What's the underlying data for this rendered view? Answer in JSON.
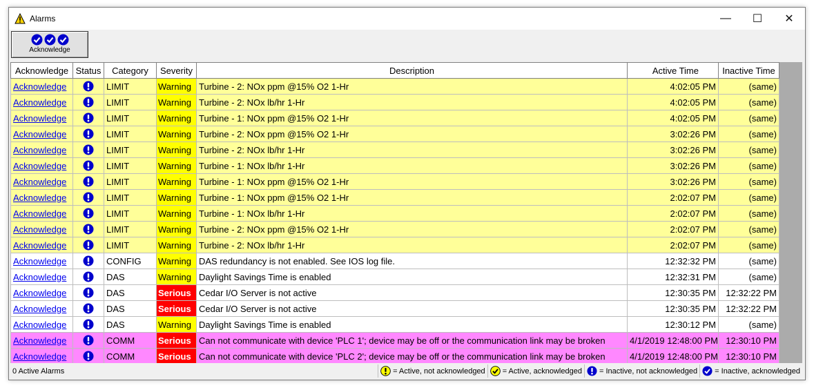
{
  "window": {
    "title": "Alarms",
    "icon": "warning-triangle-icon",
    "minimize": "—",
    "maximize": "☐",
    "close": "✕"
  },
  "toolbar": {
    "acknowledge_label": "Acknowledge"
  },
  "table": {
    "columns": [
      "Acknowledge",
      "Status",
      "Category",
      "Severity",
      "Description",
      "Active Time",
      "Inactive Time"
    ],
    "rows": [
      {
        "ack": "Acknowledge",
        "category": "LIMIT",
        "severity": "Warning",
        "description": "Turbine - 2: NOx ppm @15% O2 1-Hr",
        "active": "4:02:05 PM",
        "inactive": "(same)",
        "row_color": "yellow"
      },
      {
        "ack": "Acknowledge",
        "category": "LIMIT",
        "severity": "Warning",
        "description": "Turbine - 2: NOx lb/hr 1-Hr",
        "active": "4:02:05 PM",
        "inactive": "(same)",
        "row_color": "yellow"
      },
      {
        "ack": "Acknowledge",
        "category": "LIMIT",
        "severity": "Warning",
        "description": "Turbine - 1: NOx ppm @15% O2 1-Hr",
        "active": "4:02:05 PM",
        "inactive": "(same)",
        "row_color": "yellow"
      },
      {
        "ack": "Acknowledge",
        "category": "LIMIT",
        "severity": "Warning",
        "description": "Turbine - 2: NOx ppm @15% O2 1-Hr",
        "active": "3:02:26 PM",
        "inactive": "(same)",
        "row_color": "yellow"
      },
      {
        "ack": "Acknowledge",
        "category": "LIMIT",
        "severity": "Warning",
        "description": "Turbine - 2: NOx lb/hr 1-Hr",
        "active": "3:02:26 PM",
        "inactive": "(same)",
        "row_color": "yellow"
      },
      {
        "ack": "Acknowledge",
        "category": "LIMIT",
        "severity": "Warning",
        "description": "Turbine - 1: NOx lb/hr 1-Hr",
        "active": "3:02:26 PM",
        "inactive": "(same)",
        "row_color": "yellow"
      },
      {
        "ack": "Acknowledge",
        "category": "LIMIT",
        "severity": "Warning",
        "description": "Turbine - 1: NOx ppm @15% O2 1-Hr",
        "active": "3:02:26 PM",
        "inactive": "(same)",
        "row_color": "yellow"
      },
      {
        "ack": "Acknowledge",
        "category": "LIMIT",
        "severity": "Warning",
        "description": "Turbine - 1: NOx ppm @15% O2 1-Hr",
        "active": "2:02:07 PM",
        "inactive": "(same)",
        "row_color": "yellow"
      },
      {
        "ack": "Acknowledge",
        "category": "LIMIT",
        "severity": "Warning",
        "description": "Turbine - 1: NOx lb/hr 1-Hr",
        "active": "2:02:07 PM",
        "inactive": "(same)",
        "row_color": "yellow"
      },
      {
        "ack": "Acknowledge",
        "category": "LIMIT",
        "severity": "Warning",
        "description": "Turbine - 2: NOx ppm @15% O2 1-Hr",
        "active": "2:02:07 PM",
        "inactive": "(same)",
        "row_color": "yellow"
      },
      {
        "ack": "Acknowledge",
        "category": "LIMIT",
        "severity": "Warning",
        "description": "Turbine - 2: NOx lb/hr 1-Hr",
        "active": "2:02:07 PM",
        "inactive": "(same)",
        "row_color": "yellow"
      },
      {
        "ack": "Acknowledge",
        "category": "CONFIG",
        "severity": "Warning",
        "description": "DAS redundancy is not enabled. See IOS log file.",
        "active": "12:32:32 PM",
        "inactive": "(same)",
        "row_color": "white"
      },
      {
        "ack": "Acknowledge",
        "category": "DAS",
        "severity": "Warning",
        "description": "Daylight Savings Time is enabled",
        "active": "12:32:31 PM",
        "inactive": "(same)",
        "row_color": "white"
      },
      {
        "ack": "Acknowledge",
        "category": "DAS",
        "severity": "Serious",
        "description": "Cedar I/O Server is not active",
        "active": "12:30:35 PM",
        "inactive": "12:32:22 PM",
        "row_color": "white"
      },
      {
        "ack": "Acknowledge",
        "category": "DAS",
        "severity": "Serious",
        "description": "Cedar I/O Server is not active",
        "active": "12:30:35 PM",
        "inactive": "12:32:22 PM",
        "row_color": "white"
      },
      {
        "ack": "Acknowledge",
        "category": "DAS",
        "severity": "Warning",
        "description": "Daylight Savings Time is enabled",
        "active": "12:30:12 PM",
        "inactive": "(same)",
        "row_color": "white"
      },
      {
        "ack": "Acknowledge",
        "category": "COMM",
        "severity": "Serious",
        "description": "Can not communicate with device 'PLC 1'; device may be off or the communication link may be broken",
        "active": "4/1/2019 12:48:00 PM",
        "inactive": "12:30:10 PM",
        "row_color": "pink"
      },
      {
        "ack": "Acknowledge",
        "category": "COMM",
        "severity": "Serious",
        "description": "Can not communicate with device 'PLC 2'; device may be off or the communication link may be broken",
        "active": "4/1/2019 12:48:00 PM",
        "inactive": "12:30:10 PM",
        "row_color": "pink"
      }
    ]
  },
  "statusbar": {
    "count": "0 Active Alarms",
    "legend": [
      {
        "icon": "active-unacked-icon",
        "text": "= Active, not acknowledged"
      },
      {
        "icon": "active-acked-icon",
        "text": "= Active, acknowledged"
      },
      {
        "icon": "inactive-unacked-icon",
        "text": "= Inactive, not acknowledged"
      },
      {
        "icon": "inactive-acked-icon",
        "text": "= Inactive, acknowledged"
      }
    ]
  },
  "colors": {
    "row_yellow": "#ffff99",
    "row_pink": "#ff88ff",
    "warning": "#ffff00",
    "serious": "#ff0000",
    "status_blue": "#0000cc"
  }
}
